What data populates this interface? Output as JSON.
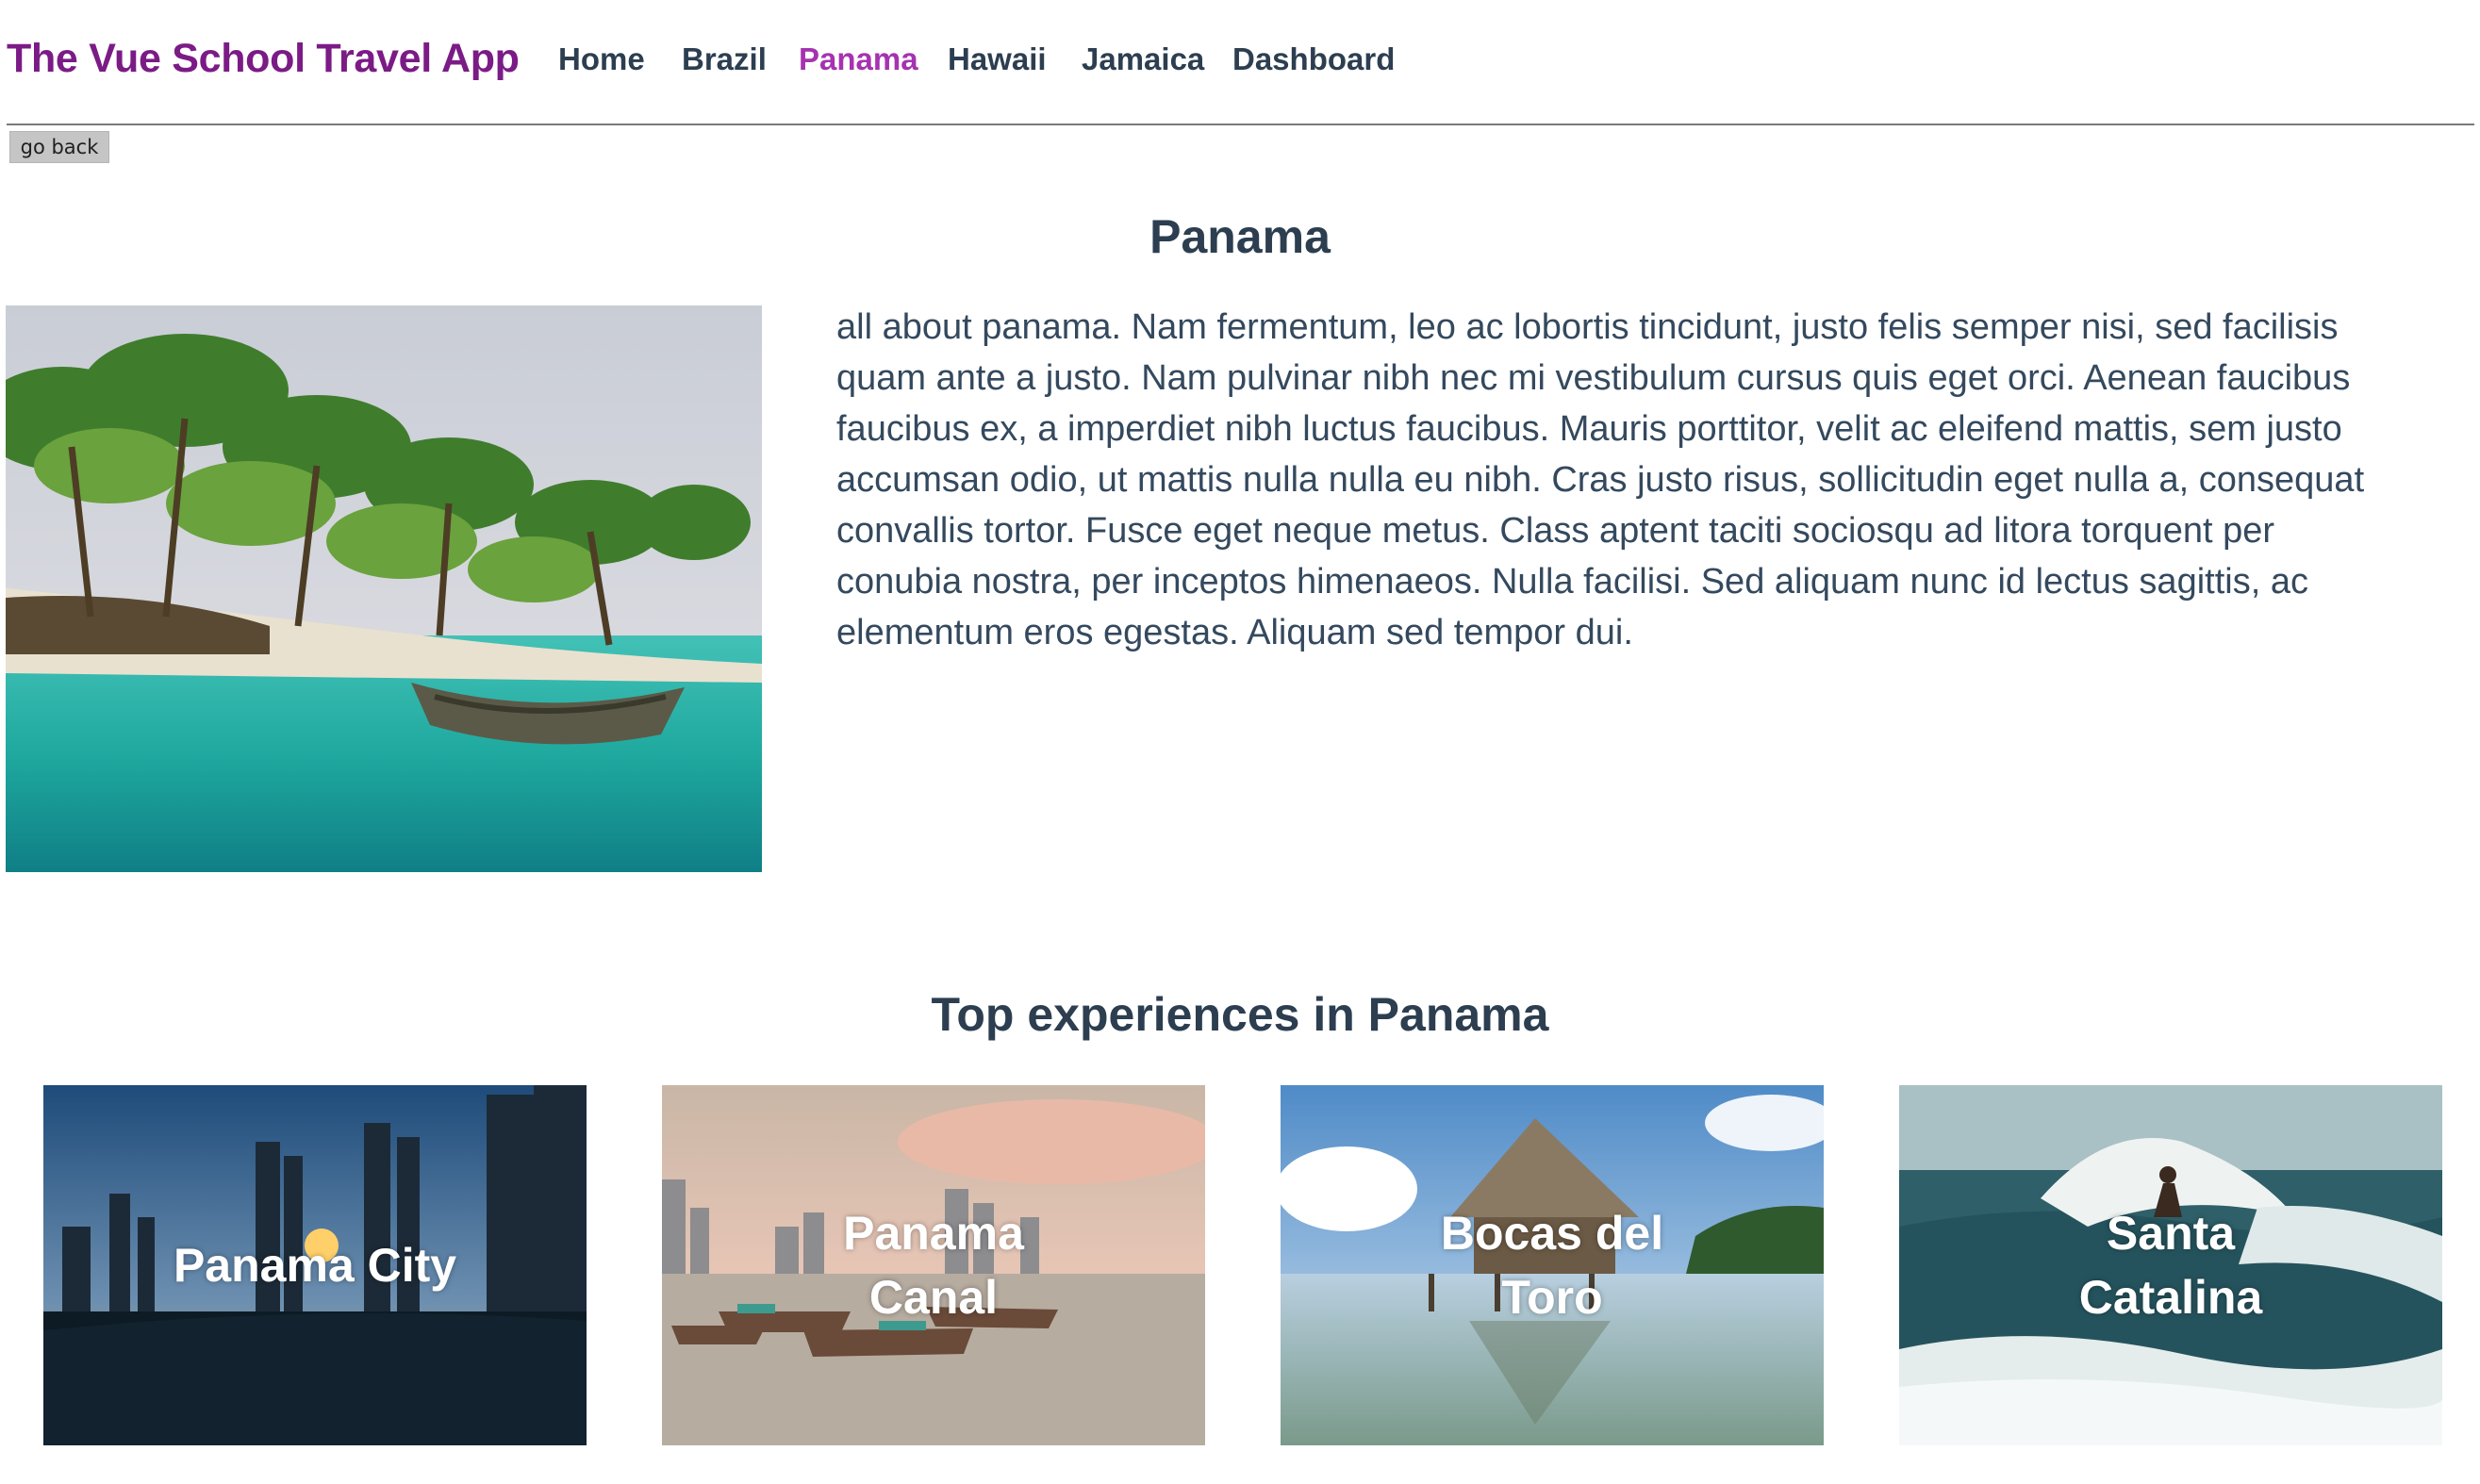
{
  "header": {
    "logo": "The Vue School Travel App",
    "nav": [
      {
        "label": "Home",
        "active": false
      },
      {
        "label": "Brazil",
        "active": false
      },
      {
        "label": "Panama",
        "active": true
      },
      {
        "label": "Hawaii",
        "active": false
      },
      {
        "label": "Jamaica",
        "active": false
      },
      {
        "label": "Dashboard",
        "active": false
      }
    ]
  },
  "go_back_label": "go back",
  "destination": {
    "title": "Panama",
    "description": "all about panama. Nam fermentum, leo ac lobortis tincidunt, justo felis semper nisi, sed facilisis quam ante a justo. Nam pulvinar nibh nec mi vestibulum cursus quis eget orci. Aenean faucibus faucibus ex, a imperdiet nibh luctus faucibus. Mauris porttitor, velit ac eleifend mattis, sem justo accumsan odio, ut mattis nulla nulla eu nibh. Cras justo risus, sollicitudin eget nulla a, consequat convallis tortor. Fusce eget neque metus. Class aptent taciti sociosqu ad litora torquent per conubia nostra, per inceptos himenaeos. Nulla facilisi. Sed aliquam nunc id lectus sagittis, ac elementum eros egestas. Aliquam sed tempor dui."
  },
  "experiences": {
    "title": "Top experiences in Panama",
    "items": [
      {
        "name": "Panama City"
      },
      {
        "name": "Panama Canal"
      },
      {
        "name": "Bocas del Toro"
      },
      {
        "name": "Santa Catalina"
      }
    ]
  },
  "colors": {
    "brand": "#7b1b86",
    "active_link": "#a533b0",
    "text": "#2c3e50"
  }
}
